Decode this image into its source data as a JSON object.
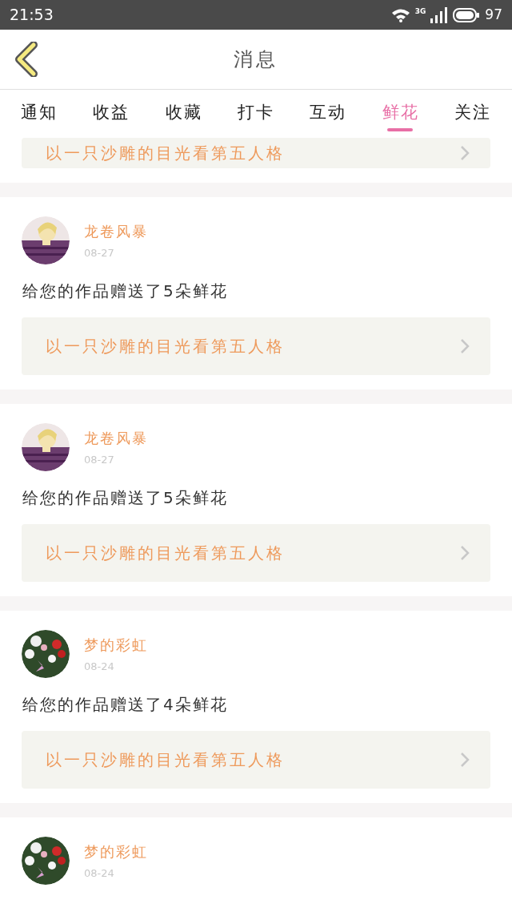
{
  "status_bar": {
    "time": "21:53",
    "network": "3G",
    "battery": "97"
  },
  "header": {
    "title": "消息"
  },
  "tabs": [
    {
      "label": "通知",
      "selected": false
    },
    {
      "label": "收益",
      "selected": false
    },
    {
      "label": "收藏",
      "selected": false
    },
    {
      "label": "打卡",
      "selected": false
    },
    {
      "label": "互动",
      "selected": false
    },
    {
      "label": "鲜花",
      "selected": true
    },
    {
      "label": "关注",
      "selected": false
    }
  ],
  "partial_card": {
    "work_title": "以一只沙雕的目光看第五人格"
  },
  "messages": [
    {
      "name": "龙卷风暴",
      "date": "08-27",
      "text": "给您的作品赠送了5朵鲜花",
      "work_title": "以一只沙雕的目光看第五人格"
    },
    {
      "name": "龙卷风暴",
      "date": "08-27",
      "text": "给您的作品赠送了5朵鲜花",
      "work_title": "以一只沙雕的目光看第五人格"
    },
    {
      "name": "梦的彩虹",
      "date": "08-24",
      "text": "给您的作品赠送了4朵鲜花",
      "work_title": "以一只沙雕的目光看第五人格"
    },
    {
      "name": "梦的彩虹",
      "date": "08-24"
    }
  ]
}
